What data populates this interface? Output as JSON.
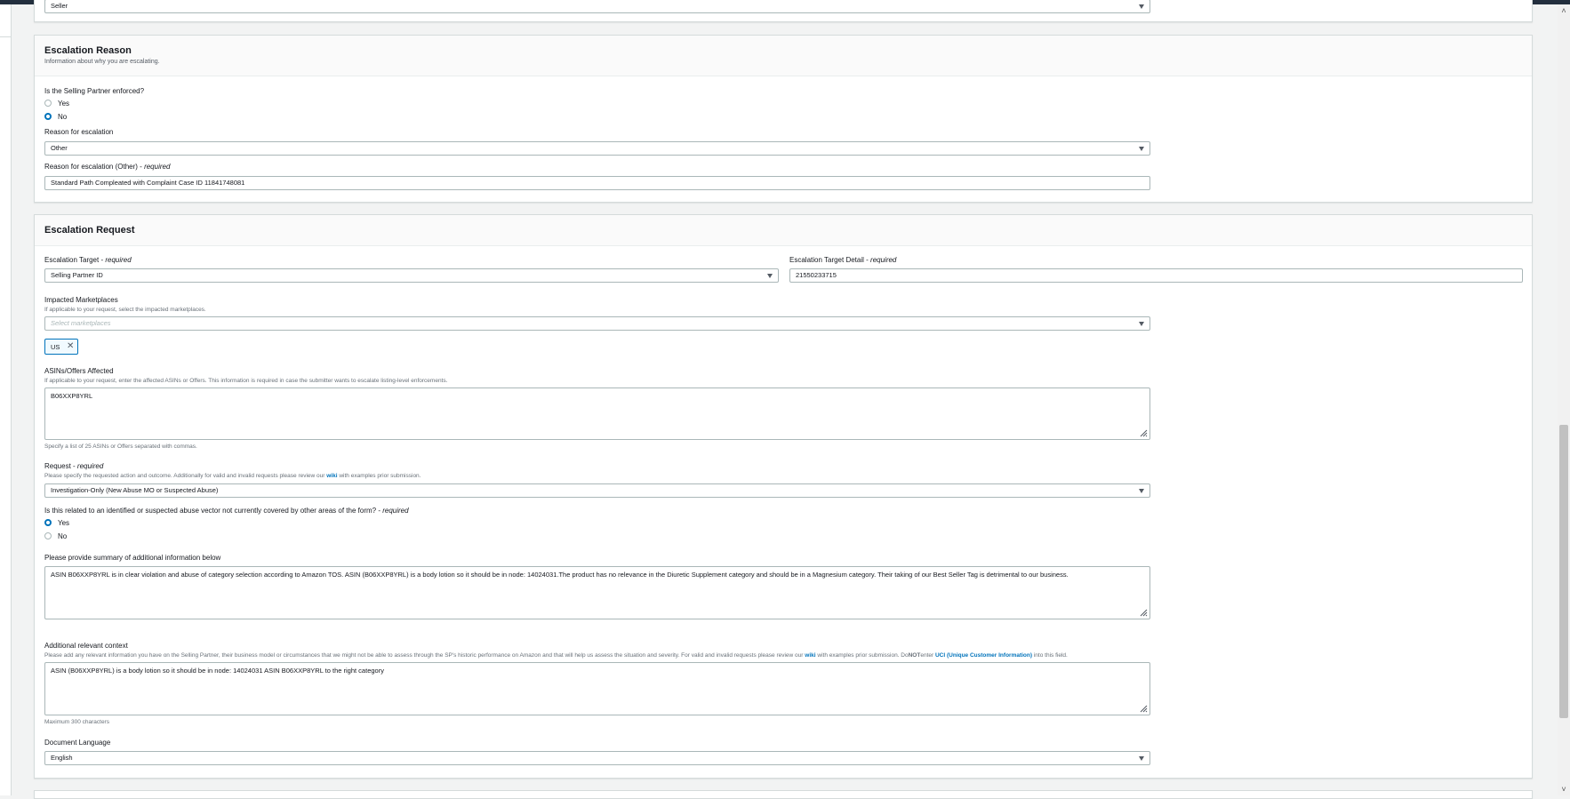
{
  "top_select": {
    "value": "Seller"
  },
  "escalation_reason": {
    "title": "Escalation Reason",
    "subtitle": "Information about why you are escalating.",
    "enforced_question": "Is the Selling Partner enforced?",
    "enforced_options": [
      "Yes",
      "No"
    ],
    "enforced_selected": "No",
    "reason_label": "Reason for escalation",
    "reason_value": "Other",
    "reason_other_label": "Reason for escalation (Other) -",
    "reason_other_required": "required",
    "reason_other_value": "Standard Path Compleated with Complaint Case ID 11841748081"
  },
  "escalation_request": {
    "title": "Escalation Request",
    "target_label": "Escalation Target -",
    "target_required": "required",
    "target_value": "Selling Partner ID",
    "target_detail_label": "Escalation Target Detail -",
    "target_detail_required": "required",
    "target_detail_value": "21550233715",
    "marketplaces_label": "Impacted Marketplaces",
    "marketplaces_desc": "If applicable to your request, select the impacted marketplaces.",
    "marketplaces_placeholder": "Select marketplaces",
    "marketplace_tokens": [
      "US"
    ],
    "asins_label": "ASINs/Offers Affected",
    "asins_desc": "If applicable to your request, enter the affected ASINs or Offers. This information is required in case the submitter wants to escalate listing-level enforcements.",
    "asins_value": "B06XXP8YRL",
    "asins_hint": "Specify a list of 25 ASINs or Offers separated with commas.",
    "request_label": "Request -",
    "request_required": "required",
    "request_desc_pre": "Please specify the requested action and outcome. Additionally for valid and invalid requests please review our",
    "request_desc_link": "wiki",
    "request_desc_post": "with examples prior submission.",
    "request_value": "Investigation-Only (New Abuse MO or Suspected Abuse)",
    "vector_question": "Is this related to an identified or suspected abuse vector not currently covered by other areas of the form? -",
    "vector_required": "required",
    "vector_options": [
      "Yes",
      "No"
    ],
    "vector_selected": "Yes",
    "summary_label": "Please provide summary of additional information below",
    "summary_value": "ASIN B06XXP8YRL is in clear violation and abuse of category selection according to Amazon TOS. ASIN (B06XXP8YRL) is a body lotion so it should be in node: 14024031.The product has no relevance in the Diuretic Supplement category and should be in a Magnesium category. Their taking of our Best Seller Tag is detrimental to our business.",
    "context_label": "Additional relevant context",
    "context_desc_pre": "Please add any relevant information you have on the Selling Partner, their business model or circumstances that we might not be able to assess through the SP's historic performance on Amazon and that will help us assess the situation and severity. For valid and invalid requests please review our",
    "context_desc_link": "wiki",
    "context_desc_mid": "with examples prior submission. Do",
    "context_desc_not": "NOT",
    "context_desc_enter": "enter",
    "context_desc_link2": "UCI (Unique Customer Information)",
    "context_desc_post": "into this field.",
    "context_value": "ASIN (B06XXP8YRL) is a body lotion so it should be in node: 14024031 ASIN B06XXP8YRL to the right category",
    "context_hint": "Maximum 300 characters",
    "language_label": "Document Language",
    "language_value": "English"
  },
  "colors": {
    "accent": "#0073bb",
    "border": "#aab7b8",
    "header_bg": "#fafafa",
    "topbar": "#232f3e"
  }
}
